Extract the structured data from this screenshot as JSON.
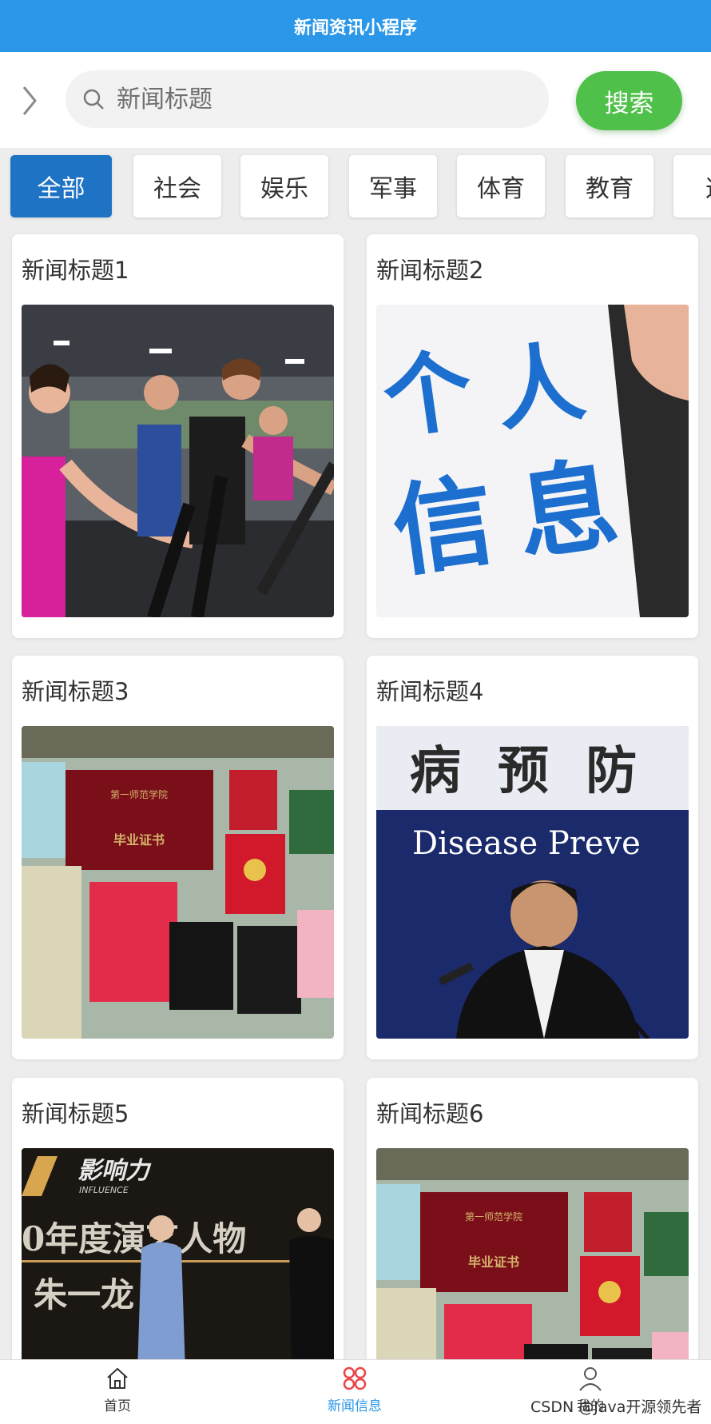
{
  "app": {
    "title": "新闻资讯小程序"
  },
  "search": {
    "placeholder": "新闻标题",
    "button_label": "搜索"
  },
  "categories": [
    "全部",
    "社会",
    "娱乐",
    "军事",
    "体育",
    "教育",
    "这"
  ],
  "news": [
    {
      "title": "新闻标题1",
      "image": "fitness-gym-photo"
    },
    {
      "title": "新闻标题2",
      "image": "personal-info-text-photo"
    },
    {
      "title": "新闻标题3",
      "image": "certificates-photo"
    },
    {
      "title": "新闻标题4",
      "image": "press-conference-photo"
    },
    {
      "title": "新闻标题5",
      "image": "award-stage-photo"
    },
    {
      "title": "新闻标题6",
      "image": "certificates-photo"
    }
  ],
  "image_text": {
    "personal_info": [
      "个",
      "人",
      "信",
      "息"
    ],
    "banner": "病 预 防",
    "banner_en": "Disease Preve",
    "award": "0年度演艺人物",
    "award_name": "朱一龙",
    "influence": "影响力",
    "influence_en": "INFLUENCE",
    "diploma": "毕业证书",
    "school": "第一师范学院"
  },
  "bottom_nav": [
    {
      "label": "首页",
      "icon": "home-icon"
    },
    {
      "label": "新闻信息",
      "icon": "grid-icon"
    },
    {
      "label": "我的",
      "icon": "user-icon"
    }
  ],
  "watermark": "CSDN @Java开源领先者",
  "colors": {
    "primary": "#2a97e8",
    "search_button": "#4fc049",
    "active_tab": "#1f73c4"
  }
}
